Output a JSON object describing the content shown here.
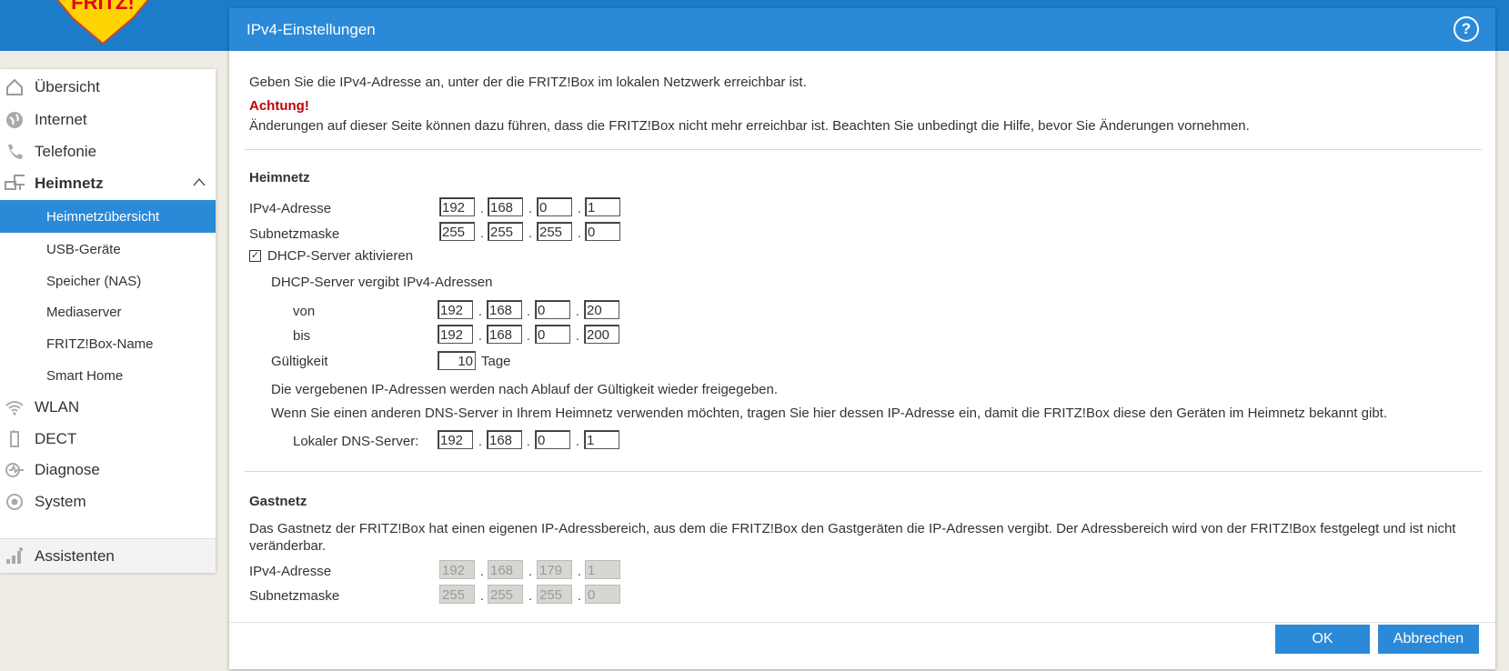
{
  "brand": {
    "logo_text": "FRITZ!"
  },
  "sidebar": {
    "items": [
      {
        "label": "Übersicht",
        "icon": "home-icon"
      },
      {
        "label": "Internet",
        "icon": "globe-icon"
      },
      {
        "label": "Telefonie",
        "icon": "phone-icon"
      },
      {
        "label": "Heimnetz",
        "icon": "network-icon"
      },
      {
        "label": "WLAN",
        "icon": "wifi-icon"
      },
      {
        "label": "DECT",
        "icon": "dect-phone-icon"
      },
      {
        "label": "Diagnose",
        "icon": "diagnose-icon"
      },
      {
        "label": "System",
        "icon": "system-icon"
      },
      {
        "label": "Assistenten",
        "icon": "assistant-icon"
      }
    ],
    "heimnetz_sub": [
      {
        "label": "Heimnetzübersicht"
      },
      {
        "label": "USB-Geräte"
      },
      {
        "label": "Speicher (NAS)"
      },
      {
        "label": "Mediaserver"
      },
      {
        "label": "FRITZ!Box-Name"
      },
      {
        "label": "Smart Home"
      }
    ]
  },
  "panel": {
    "title": "IPv4-Einstellungen",
    "help": "?",
    "intro": "Geben Sie die IPv4-Adresse an, unter der die FRITZ!Box im lokalen Netzwerk erreichbar ist.",
    "warning_title": "Achtung!",
    "warning_text": "Änderungen auf dieser Seite können dazu führen, dass die FRITZ!Box nicht mehr erreichbar ist. Beachten Sie unbedingt die Hilfe, bevor Sie Änderungen vornehmen.",
    "heimnetz": {
      "heading": "Heimnetz",
      "ipv4_label": "IPv4-Adresse",
      "ipv4": [
        "192",
        "168",
        "0",
        "1"
      ],
      "mask_label": "Subnetzmaske",
      "mask": [
        "255",
        "255",
        "255",
        "0"
      ],
      "dhcp_check": "✓",
      "dhcp_label": "DHCP-Server aktivieren",
      "dhcp_range_label": "DHCP-Server vergibt IPv4-Adressen",
      "von_label": "von",
      "von": [
        "192",
        "168",
        "0",
        "20"
      ],
      "bis_label": "bis",
      "bis": [
        "192",
        "168",
        "0",
        "200"
      ],
      "validity_label": "Gültigkeit",
      "validity_value": "10",
      "validity_unit": "Tage",
      "release_note": "Die vergebenen IP-Adressen werden nach Ablauf der Gültigkeit wieder freigegeben.",
      "dns_note": "Wenn Sie einen anderen DNS-Server in Ihrem Heimnetz verwenden möchten, tragen Sie hier dessen IP-Adresse ein, damit die FRITZ!Box diese den Geräten im Heimnetz bekannt gibt.",
      "dns_label": "Lokaler DNS-Server:",
      "dns": [
        "192",
        "168",
        "0",
        "1"
      ]
    },
    "gastnetz": {
      "heading": "Gastnetz",
      "text_line1": "Das Gastnetz der FRITZ!Box hat einen eigenen IP-Adressbereich, aus dem die FRITZ!Box den Gastgeräten die IP-Adressen vergibt. Der Adressbereich wird von der FRITZ!Box festgelegt und ist nicht",
      "text_line2": "veränderbar.",
      "ipv4_label": "IPv4-Adresse",
      "ipv4": [
        "192",
        "168",
        "179",
        "1"
      ],
      "mask_label": "Subnetzmaske",
      "mask": [
        "255",
        "255",
        "255",
        "0"
      ]
    },
    "ok_label": "OK",
    "cancel_label": "Abbrechen"
  },
  "colors": {
    "accent": "#2a8ad8",
    "topbar": "#1d7cc9",
    "warning": "#c00000"
  }
}
